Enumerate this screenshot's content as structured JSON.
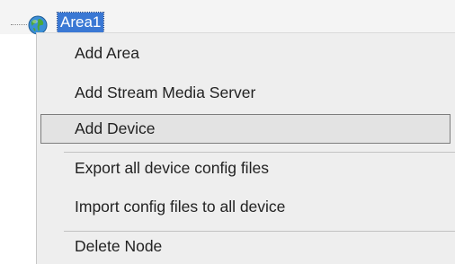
{
  "tree": {
    "node_label": "Area1",
    "node_icon": "globe-icon"
  },
  "context_menu": {
    "items": [
      {
        "label": "Add Area"
      },
      {
        "label": "Add Stream Media Server"
      },
      {
        "label": "Add Device",
        "highlighted": true
      },
      {
        "label": "Export all device config files"
      },
      {
        "label": "Import config files to all device"
      },
      {
        "label": "Delete Node"
      }
    ]
  },
  "colors": {
    "selection": "#3a78d4",
    "menu_background": "#eeeeee",
    "highlight_border": "#7d7d7d"
  }
}
